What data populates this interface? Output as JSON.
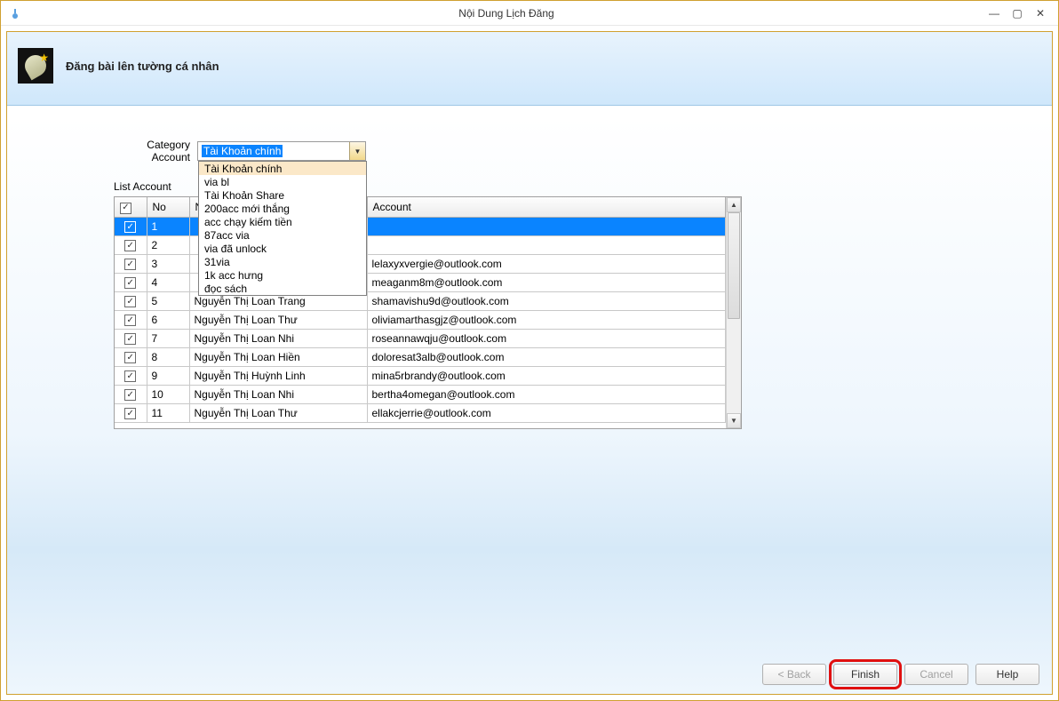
{
  "window": {
    "title": "Nội Dung Lịch Đăng"
  },
  "header": {
    "title": "Đăng bài lên tường cá nhân"
  },
  "category": {
    "label": "Category Account",
    "selected": "Tài Khoản chính",
    "options": [
      "Tài Khoản chính",
      "via bl",
      "Tài Khoản Share",
      "200acc mới thắng",
      "acc chạy kiếm tiền",
      "87acc via",
      "via đã unlock",
      "31via",
      "1k acc hưng",
      "đọc sách"
    ]
  },
  "list": {
    "label": "List Account",
    "columns": {
      "chk": "",
      "no": "No",
      "name": "Name",
      "account": "Account"
    },
    "rows": [
      {
        "checked": true,
        "selected": true,
        "no": "1",
        "name": "",
        "account": ""
      },
      {
        "checked": true,
        "selected": false,
        "no": "2",
        "name": "",
        "account": ""
      },
      {
        "checked": true,
        "selected": false,
        "no": "3",
        "name": "",
        "account": "lelaxyxvergie@outlook.com"
      },
      {
        "checked": true,
        "selected": false,
        "no": "4",
        "name": "",
        "account": "meaganm8m@outlook.com"
      },
      {
        "checked": true,
        "selected": false,
        "no": "5",
        "name": "Nguyễn Thị Loan Trang",
        "account": "shamavishu9d@outlook.com"
      },
      {
        "checked": true,
        "selected": false,
        "no": "6",
        "name": "Nguyễn Thị Loan Thư",
        "account": "oliviamarthasgjz@outlook.com"
      },
      {
        "checked": true,
        "selected": false,
        "no": "7",
        "name": "Nguyễn Thị Loan Nhi",
        "account": "roseannawqju@outlook.com"
      },
      {
        "checked": true,
        "selected": false,
        "no": "8",
        "name": "Nguyễn Thị Loan Hiền",
        "account": "doloresat3alb@outlook.com"
      },
      {
        "checked": true,
        "selected": false,
        "no": "9",
        "name": "Nguyễn Thị Huỳnh Linh",
        "account": "mina5rbrandy@outlook.com"
      },
      {
        "checked": true,
        "selected": false,
        "no": "10",
        "name": "Nguyễn Thị Loan Nhi",
        "account": "bertha4omegan@outlook.com"
      },
      {
        "checked": true,
        "selected": false,
        "no": "11",
        "name": "Nguyễn Thị Loan Thư",
        "account": "ellakcjerrie@outlook.com"
      }
    ]
  },
  "buttons": {
    "back": "< Back",
    "finish": "Finish",
    "cancel": "Cancel",
    "help": "Help"
  }
}
